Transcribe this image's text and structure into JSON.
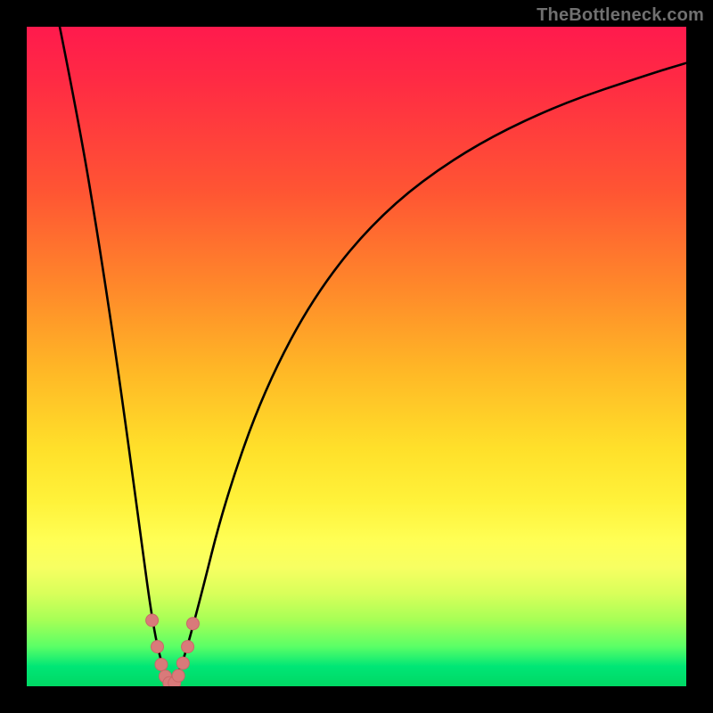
{
  "watermark": "TheBottleneck.com",
  "colors": {
    "gradient_top": "#ff1a4d",
    "gradient_mid1": "#ff8a2a",
    "gradient_mid2": "#ffe02a",
    "gradient_bottom": "#00d864",
    "curve": "#000000",
    "marker_fill": "#d97a7a",
    "marker_stroke": "#c96868",
    "frame": "#000000"
  },
  "chart_data": {
    "type": "line",
    "title": "",
    "xlabel": "",
    "ylabel": "",
    "xlim": [
      0,
      100
    ],
    "ylim": [
      0,
      100
    ],
    "legend": false,
    "grid": false,
    "series": [
      {
        "name": "bottleneck-curve",
        "description": "V-shaped curve: steep left branch, null at x≈22, shallower right branch",
        "x": [
          5,
          8,
          11,
          14,
          17,
          19,
          20.5,
          22,
          23.5,
          26,
          30,
          36,
          44,
          54,
          66,
          80,
          95,
          100
        ],
        "y": [
          100,
          85,
          67,
          47,
          25,
          10,
          3,
          0,
          3,
          12,
          28,
          45,
          60,
          72,
          81,
          88,
          93,
          94.5
        ]
      }
    ],
    "markers": [
      {
        "name": "left-branch-marker-1",
        "x": 19.0,
        "y": 10
      },
      {
        "name": "left-branch-marker-2",
        "x": 19.8,
        "y": 6
      },
      {
        "name": "left-branch-marker-3",
        "x": 20.4,
        "y": 3.3
      },
      {
        "name": "left-branch-marker-4",
        "x": 21.0,
        "y": 1.5
      },
      {
        "name": "trough-marker-1",
        "x": 21.6,
        "y": 0.5
      },
      {
        "name": "trough-marker-2",
        "x": 22.4,
        "y": 0.5
      },
      {
        "name": "right-branch-marker-1",
        "x": 23.0,
        "y": 1.6
      },
      {
        "name": "right-branch-marker-2",
        "x": 23.7,
        "y": 3.5
      },
      {
        "name": "right-branch-marker-3",
        "x": 24.4,
        "y": 6.0
      },
      {
        "name": "right-branch-marker-4",
        "x": 25.2,
        "y": 9.5
      }
    ],
    "annotations": []
  }
}
